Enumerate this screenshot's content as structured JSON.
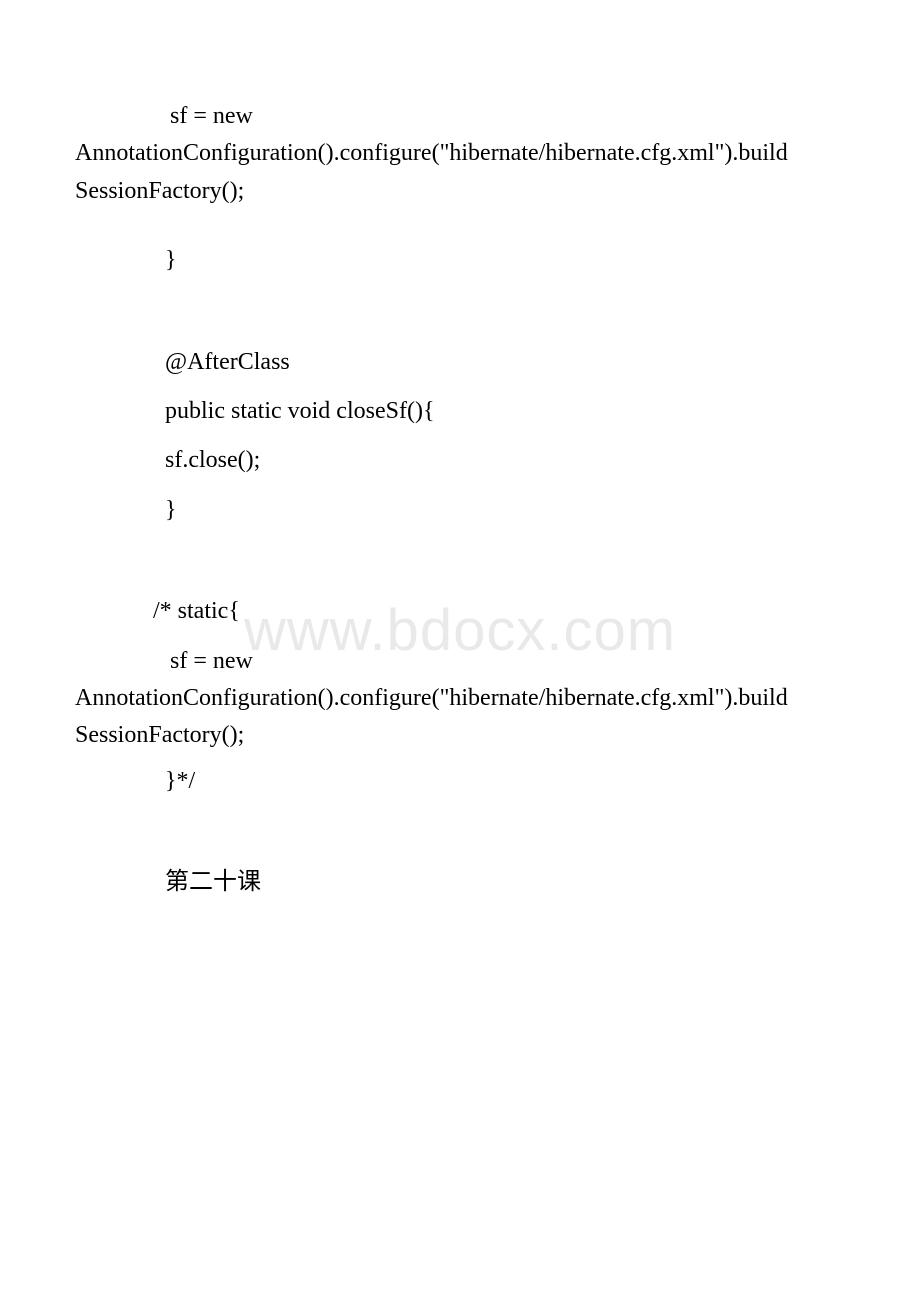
{
  "watermark": "www.bdocx.com",
  "lines": {
    "l1": "sf = new AnnotationConfiguration().configure(\"hibernate/hibernate.cfg.xml\").buildSessionFactory();",
    "l1a": "  sf = new",
    "l1b": "AnnotationConfiguration().configure(\"hibernate/hibernate.cfg.xml\").build",
    "l1c": "SessionFactory();",
    "l2": " }",
    "l3": " @AfterClass",
    "l4": " public static void closeSf(){",
    "l5": "  sf.close();",
    "l6": " }",
    "l7": "/* static{",
    "l8a": "  sf = new",
    "l8b": "AnnotationConfiguration().configure(\"hibernate/hibernate.cfg.xml\").build",
    "l8c": "SessionFactory();",
    "l9": " }*/",
    "l10": "第二十课"
  }
}
